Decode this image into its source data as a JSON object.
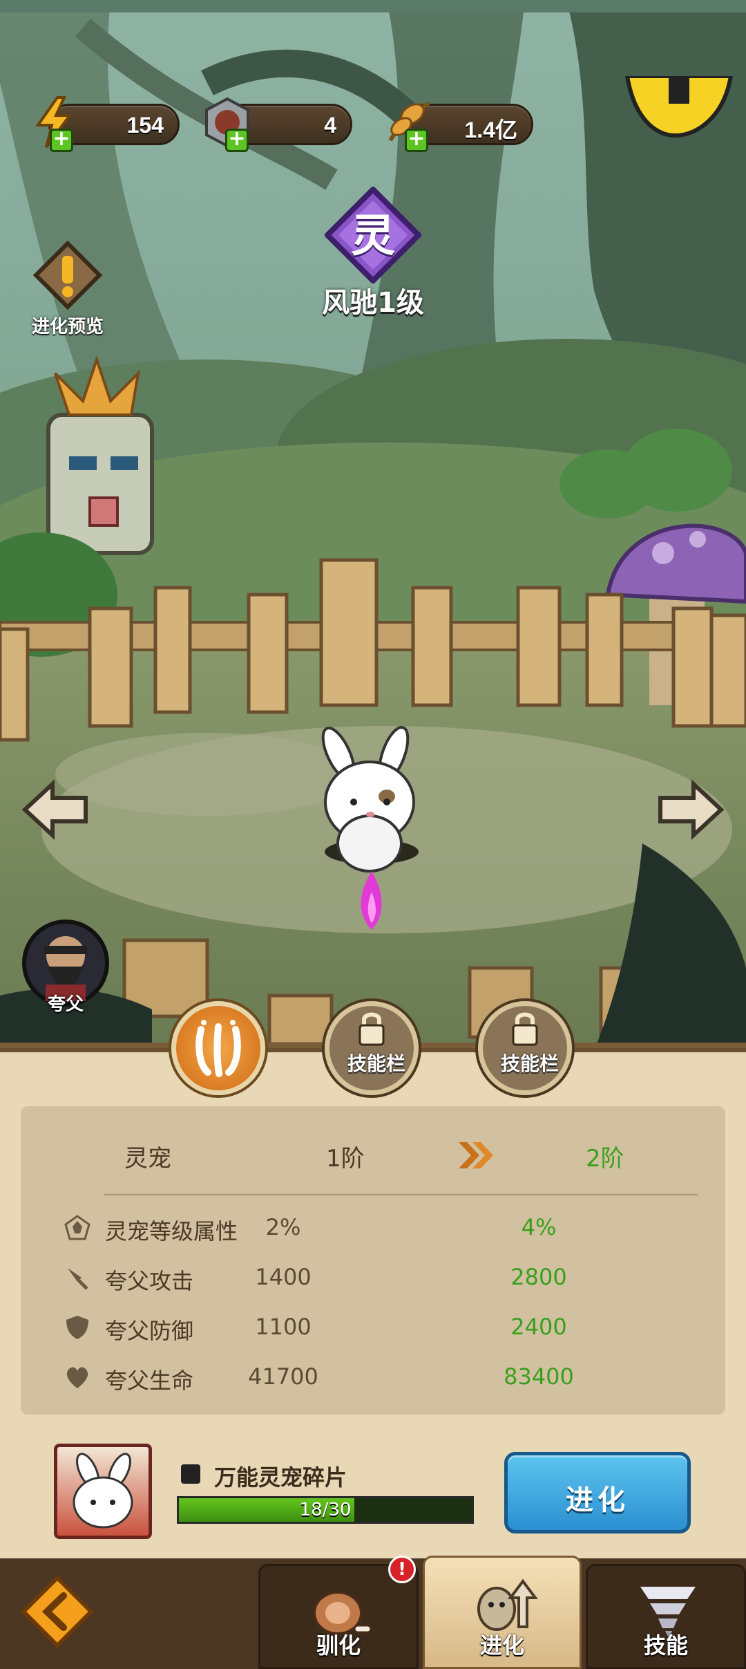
{
  "currencies": [
    {
      "name": "energy",
      "icon": "lightning-icon",
      "value": "154"
    },
    {
      "name": "token",
      "icon": "boar-token-icon",
      "value": "4"
    },
    {
      "name": "grain",
      "icon": "grain-icon",
      "value": "1.4亿"
    }
  ],
  "rank_char": "灵",
  "pet_name": "风驰1级",
  "evolution_preview": "进化预览",
  "hero_name": "夸父",
  "skill_slots": [
    {
      "label": "",
      "state": "active"
    },
    {
      "label": "技能栏",
      "state": "locked"
    },
    {
      "label": "技能栏",
      "state": "locked"
    }
  ],
  "stats": {
    "header": {
      "label": "灵宠",
      "current": "1阶",
      "next": "2阶"
    },
    "rows": [
      {
        "icon": "pentagon-icon",
        "name": "灵宠等级属性",
        "current": "2%",
        "next": "4%"
      },
      {
        "icon": "sword-icon",
        "name": "夸父攻击",
        "current": "1400",
        "next": "2800"
      },
      {
        "icon": "shield-icon",
        "name": "夸父防御",
        "current": "1100",
        "next": "2400"
      },
      {
        "icon": "heart-icon",
        "name": "夸父生命",
        "current": "41700",
        "next": "83400"
      }
    ]
  },
  "fragment": {
    "name": "万能灵宠碎片",
    "progress_text": "18/30",
    "current": 18,
    "total": 30
  },
  "evolve_button": "进化",
  "nav": {
    "tabs": [
      {
        "label": "驯化",
        "icon": "meat-icon",
        "badge": "!"
      },
      {
        "label": "进化",
        "icon": "evolve-icon",
        "active": true
      },
      {
        "label": "技能",
        "icon": "tornado-icon"
      }
    ]
  },
  "colors": {
    "panel": "#e9d8b6",
    "green_text": "#3aa01c",
    "button_blue": "#2a8fd0"
  }
}
